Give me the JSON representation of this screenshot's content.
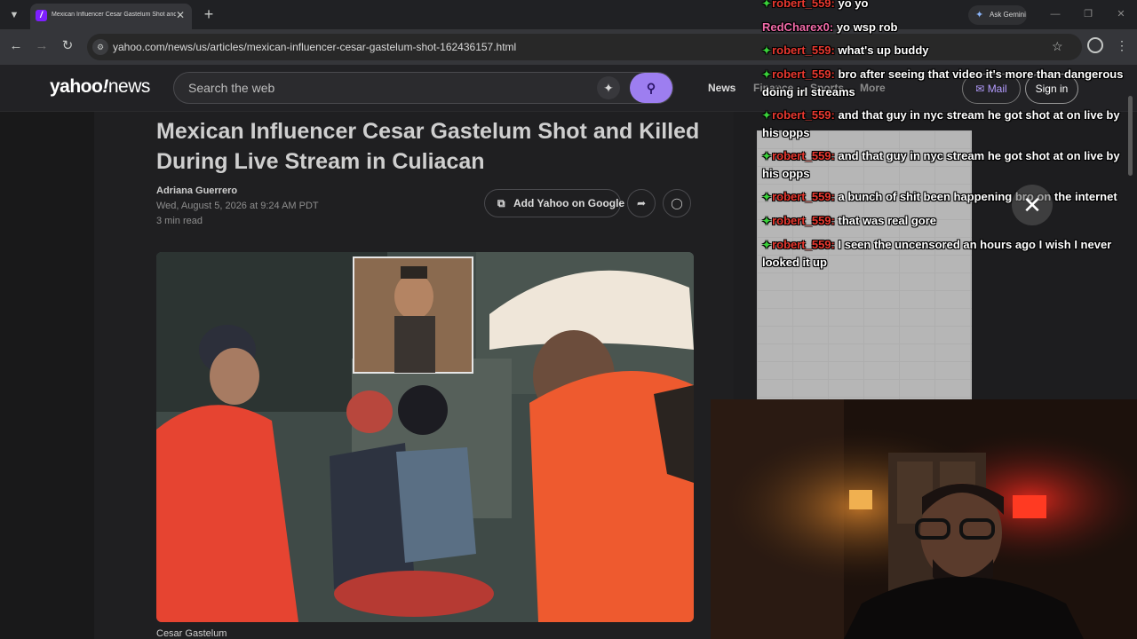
{
  "browser": {
    "tab_title": "Mexican Influencer Cesar Gastelum Shot and Killed D...",
    "favicon_letter": "/",
    "url": "yahoo.com/news/us/articles/mexican-influencer-cesar-gastelum-shot-162436157.html",
    "gemini_label": "Ask Gemini",
    "icons": {
      "tab_list": "chevron-down-icon",
      "tab_close": "close-icon",
      "new_tab": "plus-icon",
      "back": "arrow-left-icon",
      "forward": "arrow-right-icon",
      "reload": "reload-icon",
      "site_info": "site-info-icon",
      "bookmark": "star-icon",
      "profile": "profile-icon",
      "menu": "kebab-menu-icon",
      "minimize": "minimize-icon",
      "maximize": "maximize-icon",
      "close": "close-icon"
    }
  },
  "header": {
    "logo_yahoo": "yahoo",
    "logo_bang": "!",
    "logo_news": "news",
    "search_placeholder": "Search the web",
    "nav": [
      "News",
      "Finance",
      "Sports",
      "More"
    ],
    "mail_label": "Mail",
    "signin_label": "Sign in",
    "accent_color": "#9d7ef0"
  },
  "article": {
    "headline": "Mexican Influencer Cesar Gastelum Shot and Killed During Live Stream in Culiacan",
    "author": "Adriana Guerrero",
    "date": "Wed, August 5, 2026 at 9:24 AM PDT",
    "read_time": "3 min read",
    "add_google_label": "Add Yahoo on Google",
    "caption": "Cesar Gastelum"
  },
  "chat": {
    "messages": [
      {
        "user": "robert_559:",
        "text": "yo yo",
        "badge": true,
        "pink": false
      },
      {
        "user": "RedCharex0:",
        "text": "yo wsp rob",
        "badge": false,
        "pink": true
      },
      {
        "user": "robert_559:",
        "text": "what's up buddy",
        "badge": true,
        "pink": false
      },
      {
        "user": "robert_559:",
        "text": "bro after seeing that video it's more than dangerous doing irl streams",
        "badge": true,
        "pink": false
      },
      {
        "user": "robert_559:",
        "text": "and that guy in nyc stream he got shot at on live by his opps",
        "badge": true,
        "pink": false
      },
      {
        "user": "robert_559:",
        "text": "and that guy in nyc stream he got shot at on live by his opps",
        "badge": true,
        "pink": false
      },
      {
        "user": "robert_559:",
        "text": "a bunch of shit been happening bro on the internet",
        "badge": true,
        "pink": false
      },
      {
        "user": "robert_559:",
        "text": "that was real gore",
        "badge": true,
        "pink": false
      },
      {
        "user": "robert_559:",
        "text": "I seen the uncensored an hours ago I wish I never looked it up",
        "badge": true,
        "pink": false
      }
    ],
    "user_color": "#e8382f",
    "badge_color": "#39d13a"
  }
}
